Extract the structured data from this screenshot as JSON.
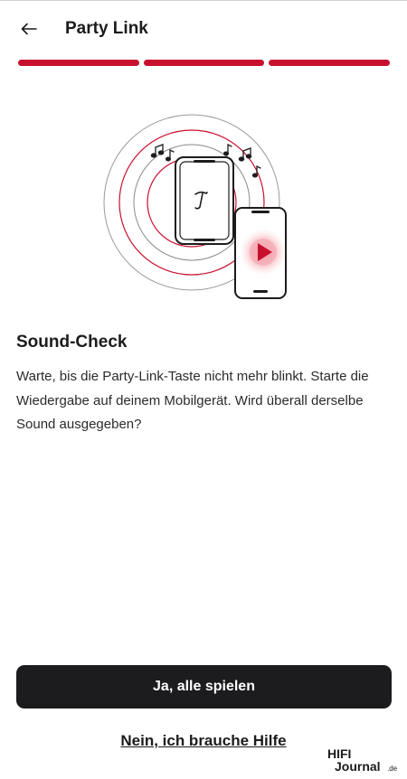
{
  "header": {
    "title": "Party Link",
    "back_icon": "arrow-left-icon"
  },
  "progress": {
    "steps_total": 3,
    "steps_completed": 3,
    "color": "#c8102e"
  },
  "illustration": {
    "icons": [
      "speaker-icon",
      "smartphone-icon",
      "play-icon",
      "music-note-icon",
      "sound-wave-rings"
    ],
    "accent": "#c8102e"
  },
  "content": {
    "heading": "Sound-Check",
    "body": "Warte, bis die Party-Link-Taste nicht mehr blinkt.  Starte die Wiedergabe auf deinem Mobilgerät. Wird überall derselbe Sound ausgegeben?"
  },
  "actions": {
    "primary_label": "Ja, alle spielen",
    "secondary_label": "Nein, ich brauche Hilfe"
  },
  "watermark": {
    "brand_top": "HIFI",
    "brand_bottom": "Journal",
    "brand_suffix": ".de"
  }
}
